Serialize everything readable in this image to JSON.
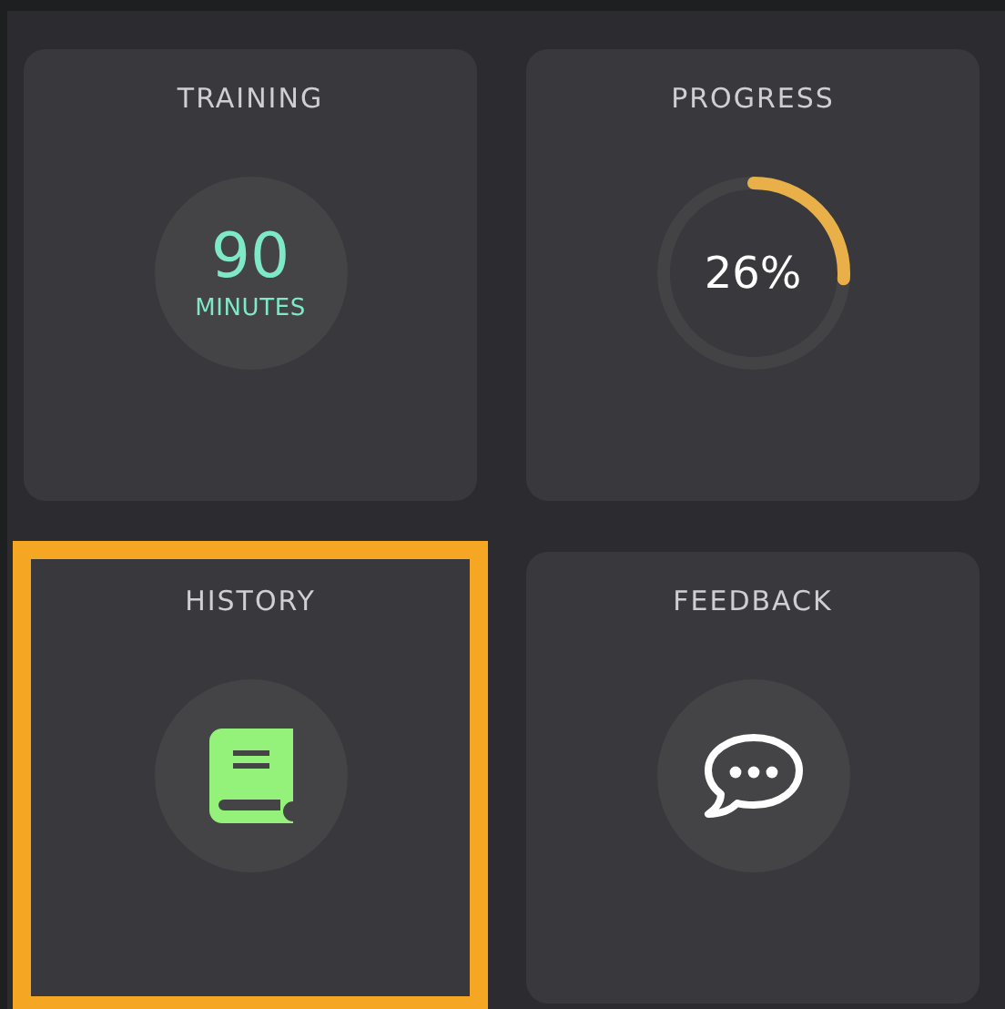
{
  "tiles": [
    {
      "kind": "minutes",
      "title": "TRAINING",
      "value": "90",
      "unit": "MINUTES",
      "selected": false
    },
    {
      "kind": "progress",
      "title": "PROGRESS",
      "value": "26%",
      "level": 0.26,
      "selected": false
    },
    {
      "kind": "book",
      "title": "HISTORY",
      "selected": true
    },
    {
      "kind": "chat",
      "title": "FEEDBACK",
      "selected": false
    }
  ]
}
